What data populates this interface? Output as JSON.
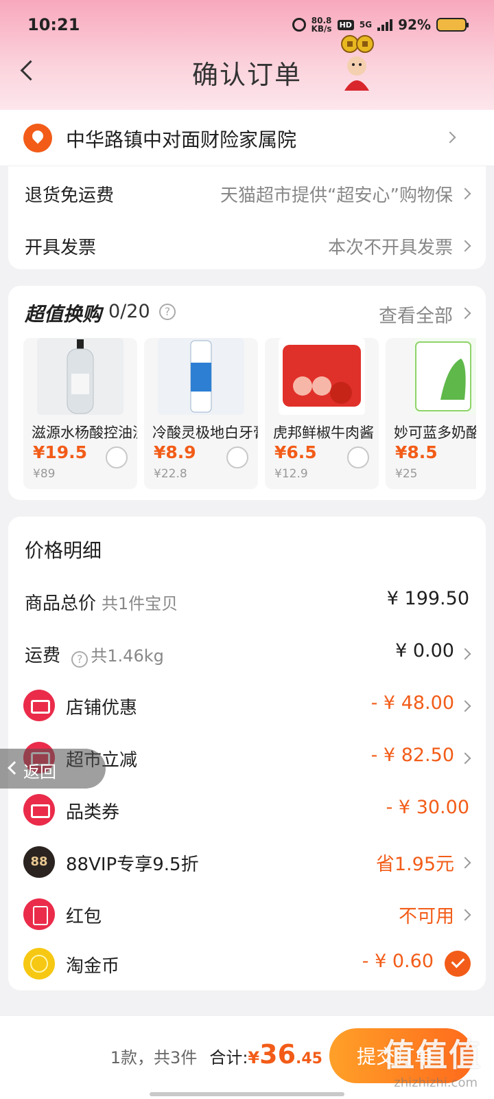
{
  "status_bar": {
    "time": "10:21",
    "net_speed_value": "80.8",
    "net_speed_unit": "KB/s",
    "hd": "HD",
    "network": "5G",
    "battery": "92%"
  },
  "nav": {
    "title": "确认订单"
  },
  "address": {
    "text": "中华路镇中对面财险家属院"
  },
  "service_rows": [
    {
      "label": "退货免运费",
      "value": "天猫超市提供“超安心”购物保"
    },
    {
      "label": "开具发票",
      "value": "本次不开具发票"
    }
  ],
  "swap": {
    "title": "超值换购",
    "count": "0/20",
    "view_all": "查看全部",
    "products": [
      {
        "name": "滋源水杨酸控油洗发水",
        "price": "¥19.5",
        "original": "¥89",
        "image_color": "#e9ebee"
      },
      {
        "name": "冷酸灵极地白牙膏",
        "price": "¥8.9",
        "original": "¥22.8",
        "image_color": "#dfe9f6"
      },
      {
        "name": "虎邦鲜椒牛肉酱",
        "price": "¥6.5",
        "original": "¥12.9",
        "image_color": "#e23a2a"
      },
      {
        "name": "妙可蓝多奶酪棒",
        "price": "¥8.5",
        "original": "¥25",
        "image_color": "#8fd36a"
      }
    ]
  },
  "price_detail": {
    "title": "价格明细",
    "goods_total": {
      "label": "商品总价",
      "sub": "共1件宝贝",
      "value": "¥ 199.50"
    },
    "shipping": {
      "label": "运费",
      "sub": "共1.46kg",
      "value": "¥ 0.00"
    },
    "discounts": [
      {
        "label": "店铺优惠",
        "value": "- ¥ 48.00",
        "icon": "ticket-icon"
      },
      {
        "label": "超市立减",
        "value": "- ¥ 82.50",
        "icon": "ticket-icon"
      },
      {
        "label": "品类券",
        "value": "- ¥ 30.00",
        "icon": "ticket-icon"
      },
      {
        "label": "88VIP专享9.5折",
        "value": "省1.95元",
        "icon": "vip-icon",
        "icon_text": "88"
      },
      {
        "label": "红包",
        "value": "不可用",
        "icon": "hongbao-icon"
      },
      {
        "label": "淘金币",
        "value": "- ¥ 0.60",
        "icon": "coin-icon"
      }
    ]
  },
  "float_back": {
    "label": "返回"
  },
  "bottom": {
    "count": "1款，共3件",
    "total_label": "合计:",
    "currency": "¥",
    "total_int": "36",
    "total_dec": ".45",
    "submit": "提交订单"
  },
  "watermark": {
    "main": "值值值",
    "sub": "zhizhizhi.com"
  },
  "colors": {
    "accent": "#f25c18",
    "header_pink": "#f8a8bc"
  }
}
